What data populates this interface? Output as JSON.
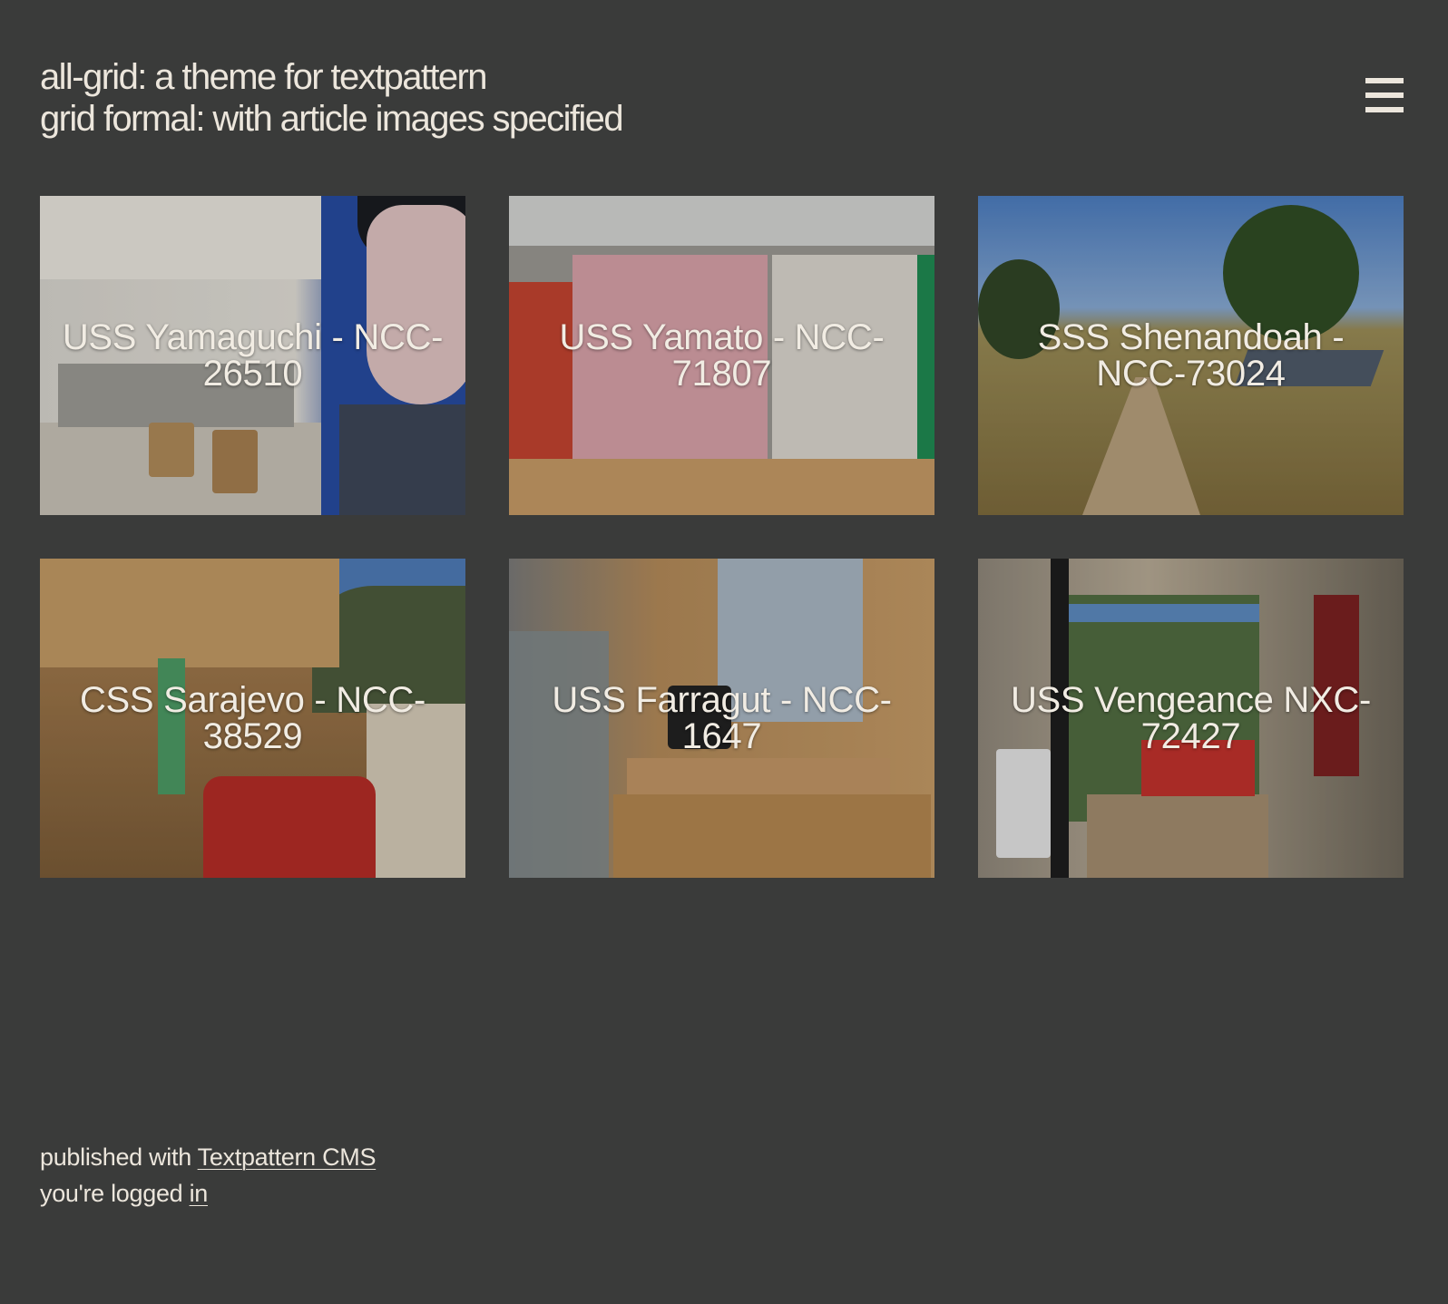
{
  "header": {
    "site_title": "all-grid: a theme for textpattern",
    "subtitle": "grid formal: with article images specified",
    "menu_icon": "hamburger-menu-icon"
  },
  "articles": [
    {
      "title": "USS Yamaguchi - NCC-26510"
    },
    {
      "title": "USS Yamato - NCC-71807"
    },
    {
      "title": "SSS Shenandoah - NCC-73024"
    },
    {
      "title": "CSS Sarajevo - NCC-38529"
    },
    {
      "title": "USS Farragut - NCC-1647"
    },
    {
      "title": "USS Vengeance NXC-72427"
    }
  ],
  "footer": {
    "published_prefix": "published with ",
    "cms_link": "Textpattern CMS",
    "logged_prefix": "you're logged ",
    "logged_link": "in"
  },
  "colors": {
    "background": "#3a3b3a",
    "text": "#ece6dc"
  }
}
